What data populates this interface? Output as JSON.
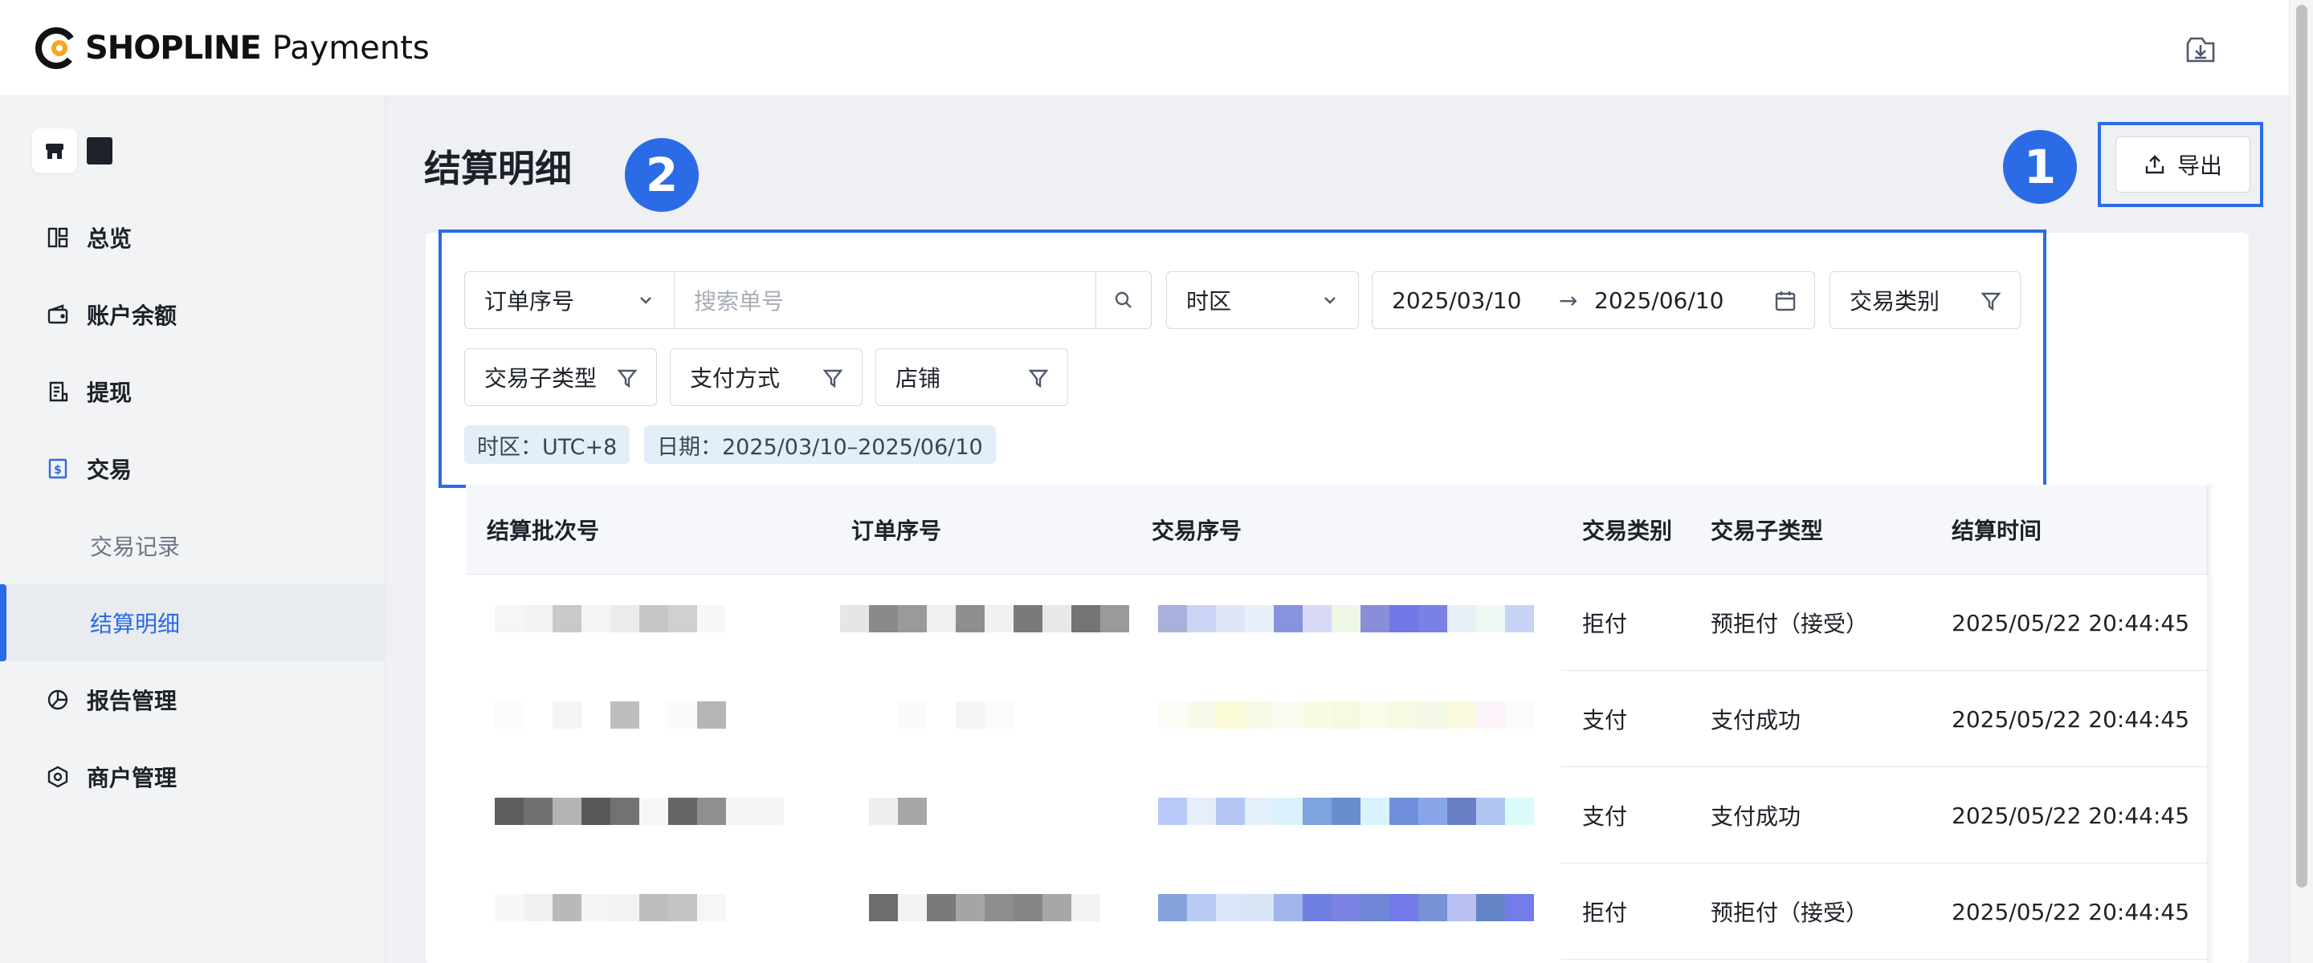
{
  "header": {
    "brand": "SHOPLINE",
    "product": "Payments",
    "download_icon": "download-icon",
    "brand_color": "#f5a623"
  },
  "sidebar": {
    "store_icon": "store-icon",
    "items": [
      {
        "label": "总览",
        "icon": "dashboard-icon"
      },
      {
        "label": "账户余额",
        "icon": "wallet-icon"
      },
      {
        "label": "提现",
        "icon": "withdraw-icon"
      },
      {
        "label": "交易",
        "icon": "transaction-icon"
      },
      {
        "label": "交易记录",
        "sub": true
      },
      {
        "label": "结算明细",
        "sub": true,
        "active": true
      },
      {
        "label": "报告管理",
        "icon": "report-icon"
      },
      {
        "label": "商户管理",
        "icon": "merchant-icon"
      }
    ]
  },
  "page": {
    "title": "结算明细",
    "annotations": [
      "1",
      "2"
    ],
    "export_label": "导出",
    "accent": "#2b6be6"
  },
  "filters": {
    "search_type": "订单序号",
    "search_placeholder": "搜索单号",
    "timezone": "时区",
    "date_start": "2025/03/10",
    "date_sep": "→",
    "date_end": "2025/06/10",
    "txn_type": "交易类别",
    "txn_subtype": "交易子类型",
    "payment_method": "支付方式",
    "store": "店铺",
    "tags": [
      "时区：UTC+8",
      "日期：2025/03/10–2025/06/10"
    ]
  },
  "table": {
    "columns": [
      "结算批次号",
      "订单序号",
      "交易序号",
      "交易类别",
      "交易子类型",
      "结算时间"
    ],
    "rows": [
      {
        "type": "拒付",
        "subtype": "预拒付（接受）",
        "time": "2025/05/22 20:44:45"
      },
      {
        "type": "支付",
        "subtype": "支付成功",
        "time": "2025/05/22 20:44:45"
      },
      {
        "type": "支付",
        "subtype": "支付成功",
        "time": "2025/05/22 20:44:45"
      },
      {
        "type": "拒付",
        "subtype": "预拒付（接受）",
        "time": "2025/05/22 20:44:45"
      }
    ]
  }
}
